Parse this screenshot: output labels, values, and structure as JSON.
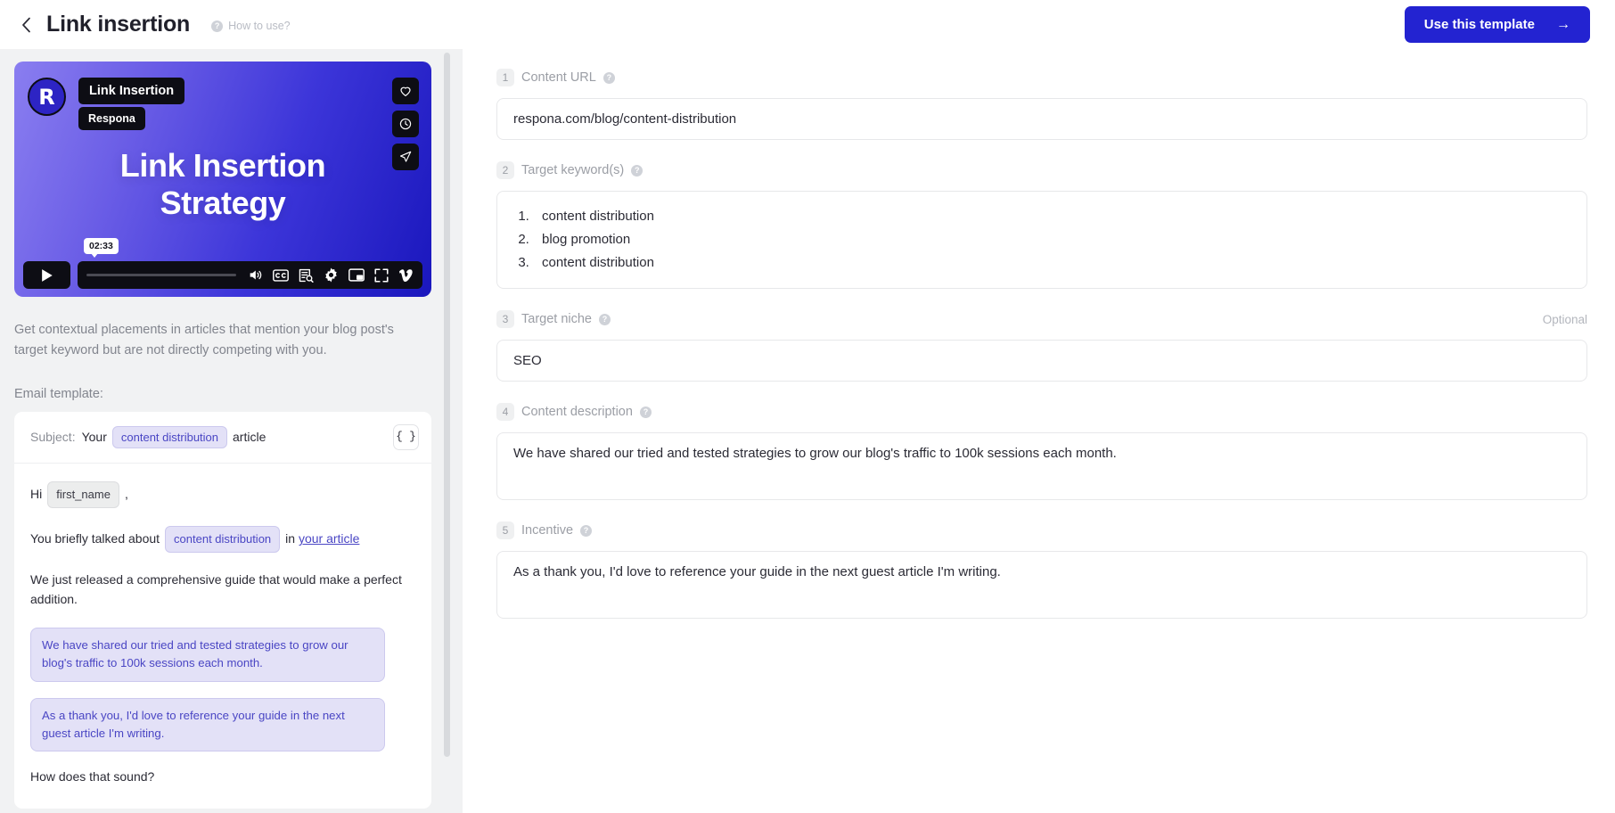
{
  "header": {
    "back_icon": "chevron-left-icon",
    "title": "Link insertion",
    "how_to_label": "How to use?",
    "help_icon": "question-circle-icon",
    "use_template_label": "Use this template",
    "arrow_icon": "arrow-right-icon",
    "accent_color": "#2323d1"
  },
  "video": {
    "logo_letter": "R",
    "title_chip": "Link Insertion",
    "brand_chip": "Respona",
    "heading_line1": "Link Insertion",
    "heading_line2": "Strategy",
    "timestamp": "02:33",
    "actions": [
      {
        "name": "like-button",
        "icon": "heart-icon"
      },
      {
        "name": "watch-later-button",
        "icon": "clock-icon"
      },
      {
        "name": "share-button",
        "icon": "paper-plane-icon"
      }
    ],
    "controls": [
      {
        "name": "play-button",
        "icon": "play-icon"
      },
      {
        "name": "volume-button",
        "icon": "volume-icon"
      },
      {
        "name": "captions-button",
        "icon": "cc-icon"
      },
      {
        "name": "transcript-button",
        "icon": "transcript-search-icon"
      },
      {
        "name": "settings-button",
        "icon": "gear-icon"
      },
      {
        "name": "picture-in-picture-button",
        "icon": "pip-icon"
      },
      {
        "name": "fullscreen-button",
        "icon": "fullscreen-icon"
      },
      {
        "name": "vimeo-logo",
        "icon": "vimeo-icon"
      }
    ]
  },
  "left": {
    "description": "Get contextual placements in articles that mention your blog post's target keyword but are not directly competing with you.",
    "email_template_label": "Email template:",
    "subject_label": "Subject:",
    "subject_prefix": "Your",
    "subject_pill": "content distribution",
    "subject_suffix": "article",
    "variables_button": "{ }",
    "greeting_prefix": "Hi",
    "greeting_pill": "first_name",
    "greeting_suffix": ",",
    "body_line1_prefix": "You briefly talked about",
    "body_line1_pill": "content distribution",
    "body_line1_mid": "in",
    "body_line1_link": "your article",
    "body_line2": "We just released a comprehensive guide that would make a perfect addition.",
    "highlight_block1": "We have shared our tried and tested strategies to grow our blog's traffic to 100k sessions each month.",
    "highlight_block2": "As a thank you, I'd love to reference your guide in the next guest article I'm writing.",
    "body_closing": "How does that sound?"
  },
  "form": {
    "fields": [
      {
        "number": "1",
        "label": "Content URL",
        "help_icon": "question-circle-icon",
        "value": "respona.com/blog/content-distribution",
        "optional": ""
      },
      {
        "number": "2",
        "label": "Target keyword(s)",
        "help_icon": "question-circle-icon",
        "optional": "",
        "keywords": [
          "content distribution",
          "blog promotion",
          "content distribution"
        ]
      },
      {
        "number": "3",
        "label": "Target niche",
        "help_icon": "question-circle-icon",
        "value": "SEO",
        "optional": "Optional"
      },
      {
        "number": "4",
        "label": "Content description",
        "help_icon": "question-circle-icon",
        "value": "We have shared our tried and tested strategies to grow our blog's traffic to 100k sessions each month.",
        "optional": ""
      },
      {
        "number": "5",
        "label": "Incentive",
        "help_icon": "question-circle-icon",
        "value": "As a thank you, I'd love to reference your guide in the next guest article I'm writing.",
        "optional": ""
      }
    ]
  }
}
